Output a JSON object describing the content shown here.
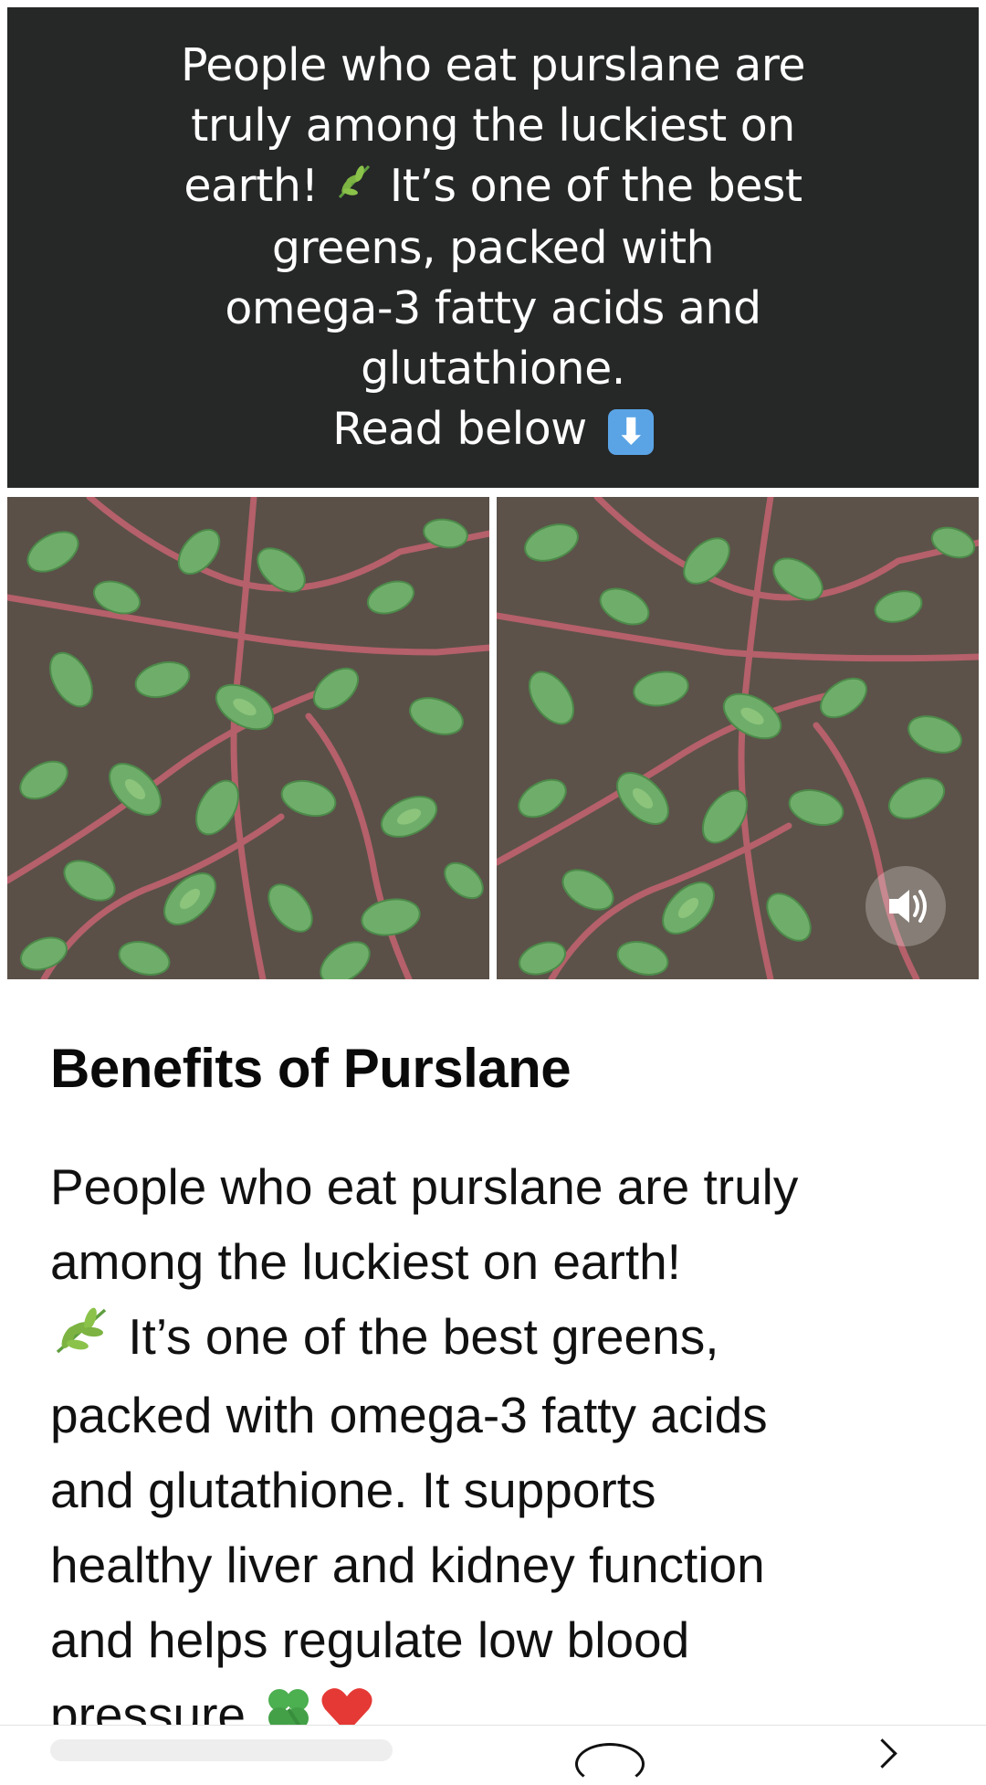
{
  "banner": {
    "lines": [
      "People who eat purslane are",
      "truly among the luckiest on",
      "earth!",
      "It’s one of the best",
      "greens, packed with",
      "omega-3 fatty acids and",
      "glutathione.",
      "Read below"
    ],
    "leaf_emoji": "🌿",
    "arrow_glyph": "⬇"
  },
  "images": {
    "left": {
      "icon": "purslane-photo"
    },
    "right": {
      "icon": "purslane-photo",
      "overlay_icon": "speaker-icon"
    }
  },
  "article": {
    "title": "Benefits of Purslane",
    "lines": [
      "People who eat purslane are truly",
      "among the luckiest on earth!",
      "It’s one of the best greens,",
      "packed with omega-3 fatty acids",
      "and glutathione. It supports",
      "healthy liver and kidney function",
      "and helps regulate low blood",
      "pressure"
    ],
    "leaf_emoji": "🌿",
    "clover_emoji": "🍀",
    "heart_emoji": "❤️"
  },
  "colors": {
    "banner_bg": "#262727",
    "banner_text": "#ffffff",
    "arrow_badge": "#5aa4e6",
    "leaf": "#5f9e3f",
    "stem": "#b5606a",
    "soil": "#5a5048"
  }
}
